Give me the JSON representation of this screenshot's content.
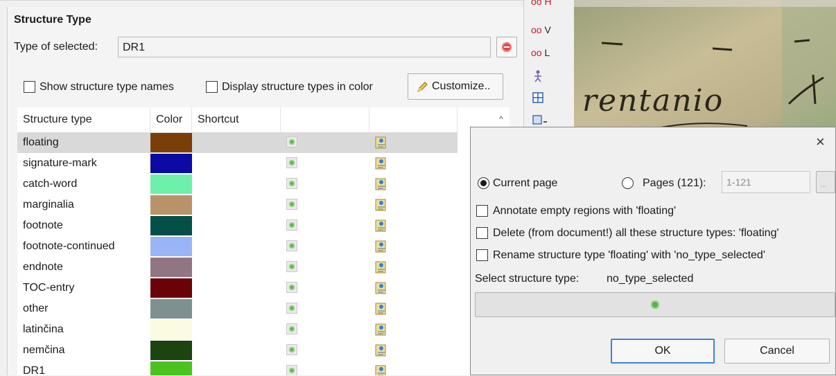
{
  "panel": {
    "title": "Structure Type",
    "type_label": "Type of selected:",
    "type_value": "DR1",
    "show_names_label": "Show structure type names",
    "display_color_label": "Display structure types in color",
    "customize_label": "Customize..",
    "columns": [
      "Structure type",
      "Color",
      "Shortcut"
    ],
    "rows": [
      {
        "name": "floating",
        "color": "#7a3f06"
      },
      {
        "name": "signature-mark",
        "color": "#0b0ba3"
      },
      {
        "name": "catch-word",
        "color": "#6ef0ab"
      },
      {
        "name": "marginalia",
        "color": "#b8936a"
      },
      {
        "name": "footnote",
        "color": "#045049"
      },
      {
        "name": "footnote-continued",
        "color": "#9ab4f8"
      },
      {
        "name": "endnote",
        "color": "#917681"
      },
      {
        "name": "TOC-entry",
        "color": "#6a0308"
      },
      {
        "name": "other",
        "color": "#7f9090"
      },
      {
        "name": "latinčina",
        "color": "#fbfbe2"
      },
      {
        "name": "nemčina",
        "color": "#1d4310"
      },
      {
        "name": "DR1",
        "color": "#4cc222"
      }
    ]
  },
  "toolbar": {
    "items": [
      "H",
      "V",
      "L"
    ]
  },
  "dialog": {
    "current_page_label": "Current page",
    "pages_label": "Pages (121):",
    "pages_value": "1-121",
    "annotate_label": "Annotate empty regions with 'floating'",
    "delete_label": "Delete (from document!) all these structure types: 'floating'",
    "rename_label": "Rename structure type 'floating' with 'no_type_selected'",
    "select_label": "Select structure type:",
    "select_value": "no_type_selected",
    "ok_label": "OK",
    "cancel_label": "Cancel"
  },
  "document_image": {
    "text": "rentanio"
  }
}
